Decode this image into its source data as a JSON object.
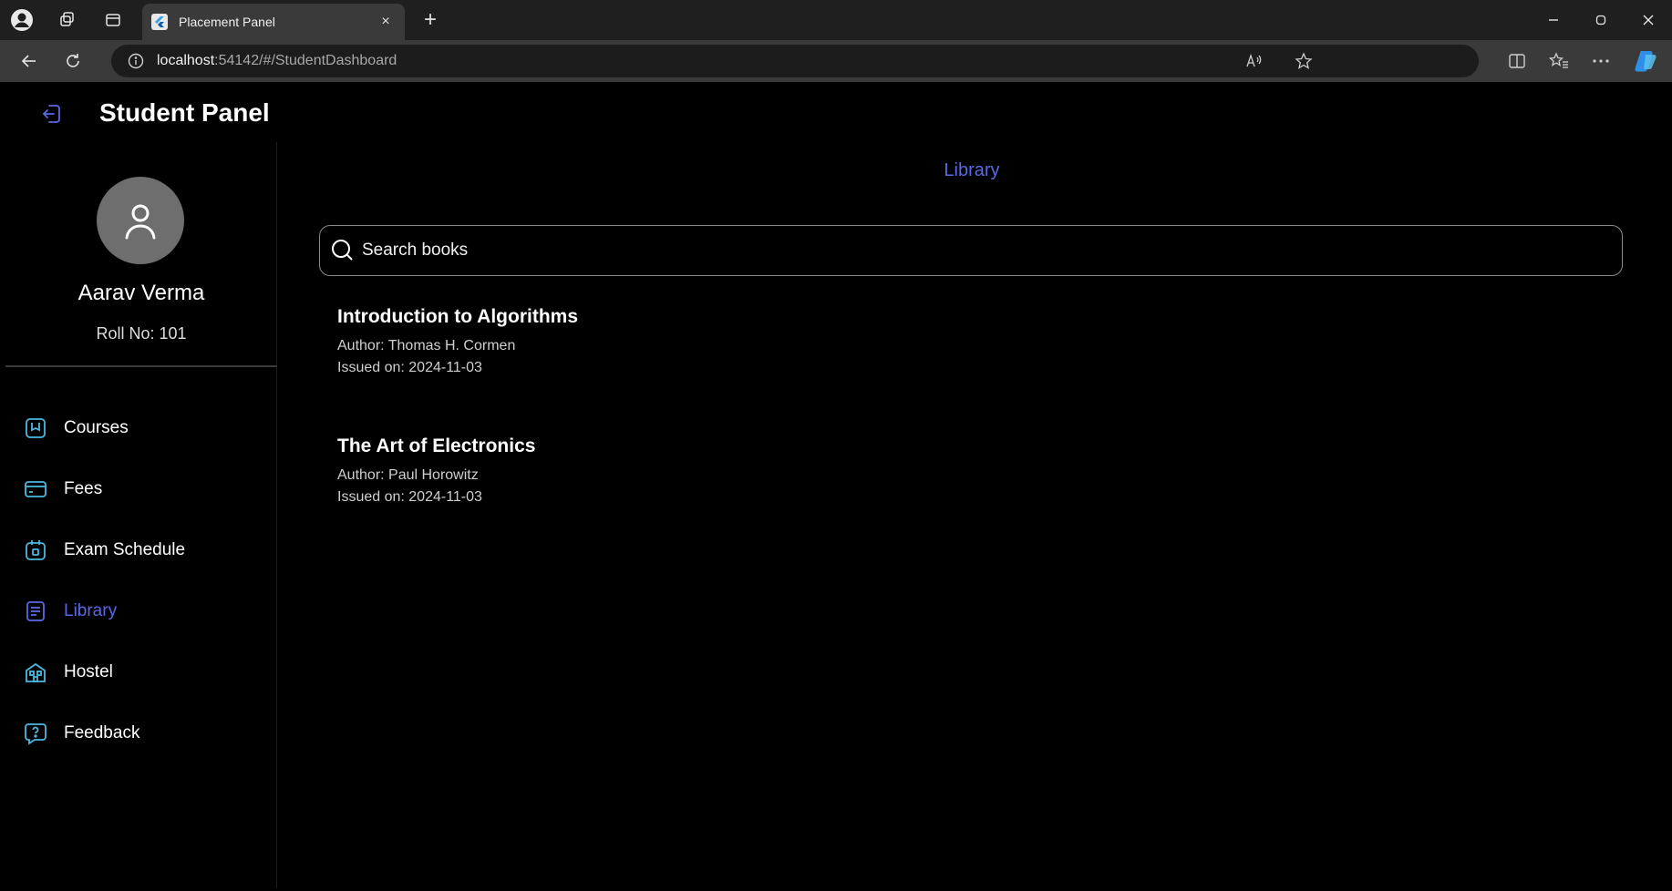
{
  "browser": {
    "tab_title": "Placement Panel",
    "url_host": "localhost",
    "url_path": ":54142/#/StudentDashboard",
    "new_tab_label": "+",
    "tab_close_label": "×"
  },
  "header": {
    "title": "Student Panel"
  },
  "profile": {
    "name": "Aarav Verma",
    "roll": "Roll No: 101"
  },
  "sidebar": {
    "items": [
      {
        "label": "Courses",
        "icon": "book-icon",
        "active": false
      },
      {
        "label": "Fees",
        "icon": "card-icon",
        "active": false
      },
      {
        "label": "Exam Schedule",
        "icon": "calendar-icon",
        "active": false
      },
      {
        "label": "Library",
        "icon": "library-icon",
        "active": true
      },
      {
        "label": "Hostel",
        "icon": "building-icon",
        "active": false
      },
      {
        "label": "Feedback",
        "icon": "feedback-icon",
        "active": false
      }
    ]
  },
  "main": {
    "title": "Library",
    "search": {
      "placeholder": "Search books",
      "value": ""
    },
    "books": [
      {
        "title": "Introduction to Algorithms",
        "author": "Author: Thomas H. Cormen",
        "issued": "Issued on: 2024-11-03"
      },
      {
        "title": "The Art of Electronics",
        "author": "Author: Paul Horowitz",
        "issued": "Issued on: 2024-11-03"
      }
    ]
  },
  "colors": {
    "accent": "#5a68e6",
    "icon_teal": "#4cb8e0",
    "background": "#000000"
  }
}
